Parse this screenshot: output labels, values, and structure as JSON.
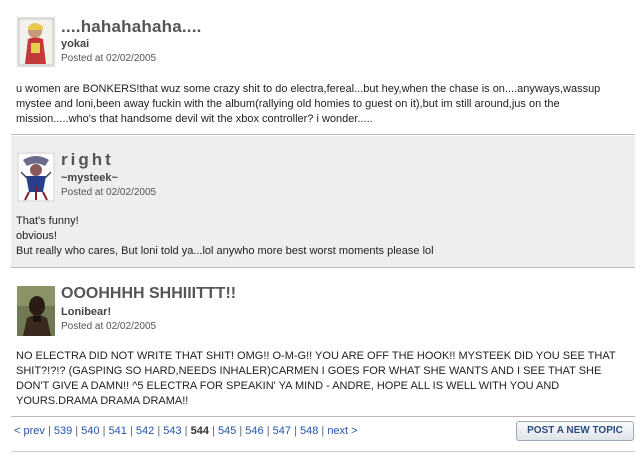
{
  "posts": [
    {
      "title": "....hahahahaha....",
      "author": "yokai",
      "posted": "Posted at 02/02/2005",
      "body": [
        "u women are BONKERS!that wuz some crazy shit to do electra,fereal...but hey,when the chase is on....anyways,wassup mystee and loni,been away fuckin with the album(rallying old homies to guest on it),but im still around,jus on the mission.....who's that handsome devil wit the xbox controller? i wonder....."
      ]
    },
    {
      "title": "right",
      "author": "~mysteek~",
      "posted": "Posted at 02/02/2005",
      "body": [
        "That's funny!",
        "obvious!",
        "But really who cares, But loni told ya...lol anywho more best worst moments please lol"
      ]
    },
    {
      "title": "OOOHHHH SHHIIITTT!!",
      "author": "Lonibear!",
      "posted": "Posted at 02/02/2005",
      "body": [
        "NO ELECTRA DID NOT WRITE THAT SHIT! OMG!! O-M-G!! YOU ARE OFF THE HOOK!! MYSTEEK DID YOU SEE THAT SHIT?!?!? (GASPING SO HARD,NEEDS INHALER)CARMEN I GOES FOR WHAT SHE WANTS AND I SEE THAT SHE DON'T GIVE A DAMN!! ^5 ELECTRA FOR SPEAKIN' YA MIND - ANDRE, HOPE ALL IS WELL WITH YOU AND YOURS.DRAMA DRAMA DRAMA!!"
      ]
    }
  ],
  "pagination": {
    "prev": "< prev",
    "pages": [
      "539",
      "540",
      "541",
      "542",
      "543",
      "544",
      "545",
      "546",
      "547",
      "548"
    ],
    "current": "544",
    "next": "next >"
  },
  "new_topic_label": "POST A NEW TOPIC"
}
